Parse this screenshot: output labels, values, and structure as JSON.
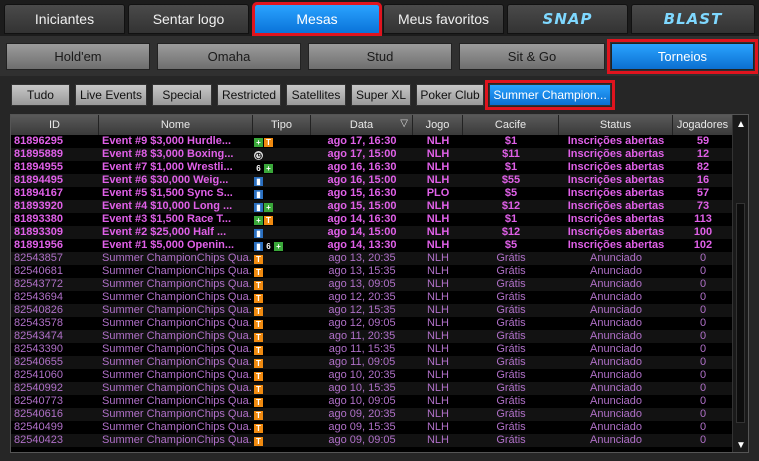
{
  "top_tabs": [
    {
      "label": "Iniciantes",
      "selected": false
    },
    {
      "label": "Sentar logo",
      "selected": false
    },
    {
      "label": "Mesas",
      "selected": true
    },
    {
      "label": "Meus favoritos",
      "selected": false
    },
    {
      "label": "SNAP",
      "selected": false
    },
    {
      "label": "BLAST",
      "selected": false
    }
  ],
  "game_tabs": [
    {
      "label": "Hold'em",
      "selected": false
    },
    {
      "label": "Omaha",
      "selected": false
    },
    {
      "label": "Stud",
      "selected": false
    },
    {
      "label": "Sit & Go",
      "selected": false
    },
    {
      "label": "Torneios",
      "selected": true
    }
  ],
  "filter_tabs": [
    {
      "label": "Tudo",
      "selected": false
    },
    {
      "label": "Live Events",
      "selected": false
    },
    {
      "label": "Special",
      "selected": false
    },
    {
      "label": "Restricted",
      "selected": false
    },
    {
      "label": "Satellites",
      "selected": false
    },
    {
      "label": "Super XL",
      "selected": false
    },
    {
      "label": "Poker Club",
      "selected": false
    },
    {
      "label": "Summer Champion...",
      "selected": true
    }
  ],
  "columns": [
    "ID",
    "Nome",
    "Tipo",
    "Data",
    "Jogo",
    "Cacife",
    "Status",
    "Jogadores"
  ],
  "colors": {
    "highlight_text": "#e060e8",
    "normal_text": "#b070c8",
    "accent_blue": "#0b7ae0",
    "red_outline": "#e0141e"
  },
  "rows": [
    {
      "id": "81896295",
      "name": "Event #9 $3,000 Hurdle...",
      "tipo": [
        "plus-icon",
        "t-icon"
      ],
      "date": "ago 17, 16:30",
      "game": "NLH",
      "buyin": "$1",
      "status": "Inscrições abertas",
      "players": "59",
      "highlight": true
    },
    {
      "id": "81895889",
      "name": "Event #8 $3,000 Boxing...",
      "tipo": [
        "clock-icon"
      ],
      "date": "ago 17, 15:00",
      "game": "NLH",
      "buyin": "$11",
      "status": "Inscrições abertas",
      "players": "12",
      "highlight": true
    },
    {
      "id": "81894955",
      "name": "Event #7 $1,000 Wrestli...",
      "tipo": [
        "six-icon",
        "plus-icon"
      ],
      "date": "ago 16, 16:30",
      "game": "NLH",
      "buyin": "$1",
      "status": "Inscrições abertas",
      "players": "82",
      "highlight": true
    },
    {
      "id": "81894495",
      "name": "Event #6 $30,000 Weig...",
      "tipo": [
        "bars-icon"
      ],
      "date": "ago 16, 15:00",
      "game": "NLH",
      "buyin": "$55",
      "status": "Inscrições abertas",
      "players": "16",
      "highlight": true
    },
    {
      "id": "81894167",
      "name": "Event #5 $1,500 Sync S...",
      "tipo": [
        "bars-icon"
      ],
      "date": "ago 15, 16:30",
      "game": "PLO",
      "buyin": "$5",
      "status": "Inscrições abertas",
      "players": "57",
      "highlight": true
    },
    {
      "id": "81893920",
      "name": "Event #4 $10,000 Long ...",
      "tipo": [
        "bars-icon",
        "plus-icon"
      ],
      "date": "ago 15, 15:00",
      "game": "NLH",
      "buyin": "$12",
      "status": "Inscrições abertas",
      "players": "73",
      "highlight": true
    },
    {
      "id": "81893380",
      "name": "Event #3 $1,500 Race T...",
      "tipo": [
        "plus-icon",
        "t-icon"
      ],
      "date": "ago 14, 16:30",
      "game": "NLH",
      "buyin": "$1",
      "status": "Inscrições abertas",
      "players": "113",
      "highlight": true
    },
    {
      "id": "81893309",
      "name": "Event #2 $25,000 Half ...",
      "tipo": [
        "bars-icon"
      ],
      "date": "ago 14, 15:00",
      "game": "NLH",
      "buyin": "$12",
      "status": "Inscrições abertas",
      "players": "100",
      "highlight": true
    },
    {
      "id": "81891956",
      "name": "Event #1 $5,000 Openin...",
      "tipo": [
        "bars-icon",
        "six-icon",
        "plus-icon"
      ],
      "date": "ago 14, 13:30",
      "game": "NLH",
      "buyin": "$5",
      "status": "Inscrições abertas",
      "players": "102",
      "highlight": true
    },
    {
      "id": "82543857",
      "name": "Summer ChampionChips Qua...",
      "tipo": [
        "t-icon"
      ],
      "date": "ago 13, 20:35",
      "game": "NLH",
      "buyin": "Grátis",
      "status": "Anunciado",
      "players": "0",
      "highlight": false
    },
    {
      "id": "82540681",
      "name": "Summer ChampionChips Qua...",
      "tipo": [
        "t-icon"
      ],
      "date": "ago 13, 15:35",
      "game": "NLH",
      "buyin": "Grátis",
      "status": "Anunciado",
      "players": "0",
      "highlight": false
    },
    {
      "id": "82543772",
      "name": "Summer ChampionChips Qua...",
      "tipo": [
        "t-icon"
      ],
      "date": "ago 13, 09:05",
      "game": "NLH",
      "buyin": "Grátis",
      "status": "Anunciado",
      "players": "0",
      "highlight": false
    },
    {
      "id": "82543694",
      "name": "Summer ChampionChips Qua...",
      "tipo": [
        "t-icon"
      ],
      "date": "ago 12, 20:35",
      "game": "NLH",
      "buyin": "Grátis",
      "status": "Anunciado",
      "players": "0",
      "highlight": false
    },
    {
      "id": "82540826",
      "name": "Summer ChampionChips Qua...",
      "tipo": [
        "t-icon"
      ],
      "date": "ago 12, 15:35",
      "game": "NLH",
      "buyin": "Grátis",
      "status": "Anunciado",
      "players": "0",
      "highlight": false
    },
    {
      "id": "82543578",
      "name": "Summer ChampionChips Qua...",
      "tipo": [
        "t-icon"
      ],
      "date": "ago 12, 09:05",
      "game": "NLH",
      "buyin": "Grátis",
      "status": "Anunciado",
      "players": "0",
      "highlight": false
    },
    {
      "id": "82543474",
      "name": "Summer ChampionChips Qua...",
      "tipo": [
        "t-icon"
      ],
      "date": "ago 11, 20:35",
      "game": "NLH",
      "buyin": "Grátis",
      "status": "Anunciado",
      "players": "0",
      "highlight": false
    },
    {
      "id": "82543390",
      "name": "Summer ChampionChips Qua...",
      "tipo": [
        "t-icon"
      ],
      "date": "ago 11, 15:35",
      "game": "NLH",
      "buyin": "Grátis",
      "status": "Anunciado",
      "players": "0",
      "highlight": false
    },
    {
      "id": "82540655",
      "name": "Summer ChampionChips Qua...",
      "tipo": [
        "t-icon"
      ],
      "date": "ago 11, 09:05",
      "game": "NLH",
      "buyin": "Grátis",
      "status": "Anunciado",
      "players": "0",
      "highlight": false
    },
    {
      "id": "82541060",
      "name": "Summer ChampionChips Qua...",
      "tipo": [
        "t-icon"
      ],
      "date": "ago 10, 20:35",
      "game": "NLH",
      "buyin": "Grátis",
      "status": "Anunciado",
      "players": "0",
      "highlight": false
    },
    {
      "id": "82540992",
      "name": "Summer ChampionChips Qua...",
      "tipo": [
        "t-icon"
      ],
      "date": "ago 10, 15:35",
      "game": "NLH",
      "buyin": "Grátis",
      "status": "Anunciado",
      "players": "0",
      "highlight": false
    },
    {
      "id": "82540773",
      "name": "Summer ChampionChips Qua...",
      "tipo": [
        "t-icon"
      ],
      "date": "ago 10, 09:05",
      "game": "NLH",
      "buyin": "Grátis",
      "status": "Anunciado",
      "players": "0",
      "highlight": false
    },
    {
      "id": "82540616",
      "name": "Summer ChampionChips Qua...",
      "tipo": [
        "t-icon"
      ],
      "date": "ago 09, 20:35",
      "game": "NLH",
      "buyin": "Grátis",
      "status": "Anunciado",
      "players": "0",
      "highlight": false
    },
    {
      "id": "82540499",
      "name": "Summer ChampionChips Qua...",
      "tipo": [
        "t-icon"
      ],
      "date": "ago 09, 15:35",
      "game": "NLH",
      "buyin": "Grátis",
      "status": "Anunciado",
      "players": "0",
      "highlight": false
    },
    {
      "id": "82540423",
      "name": "Summer ChampionChips Qua...",
      "tipo": [
        "t-icon"
      ],
      "date": "ago 09, 09:05",
      "game": "NLH",
      "buyin": "Grátis",
      "status": "Anunciado",
      "players": "0",
      "highlight": false
    }
  ]
}
